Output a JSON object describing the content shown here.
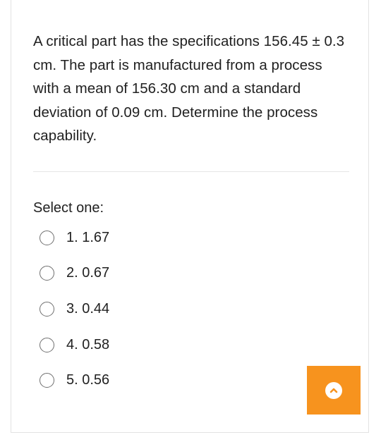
{
  "question": {
    "text": "A critical part has the specifications 156.45 ± 0.3 cm. The part is manufactured from a process with a mean of 156.30 cm and a standard deviation of 0.09 cm. Determine the process capability."
  },
  "answer_prompt": "Select one:",
  "options": [
    {
      "label": "1. 1.67"
    },
    {
      "label": "2. 0.67"
    },
    {
      "label": "3. 0.44"
    },
    {
      "label": "4. 0.58"
    },
    {
      "label": "5. 0.56"
    }
  ],
  "scroll_button": {
    "icon": "chevron-up-icon",
    "color": "#f7931e"
  }
}
